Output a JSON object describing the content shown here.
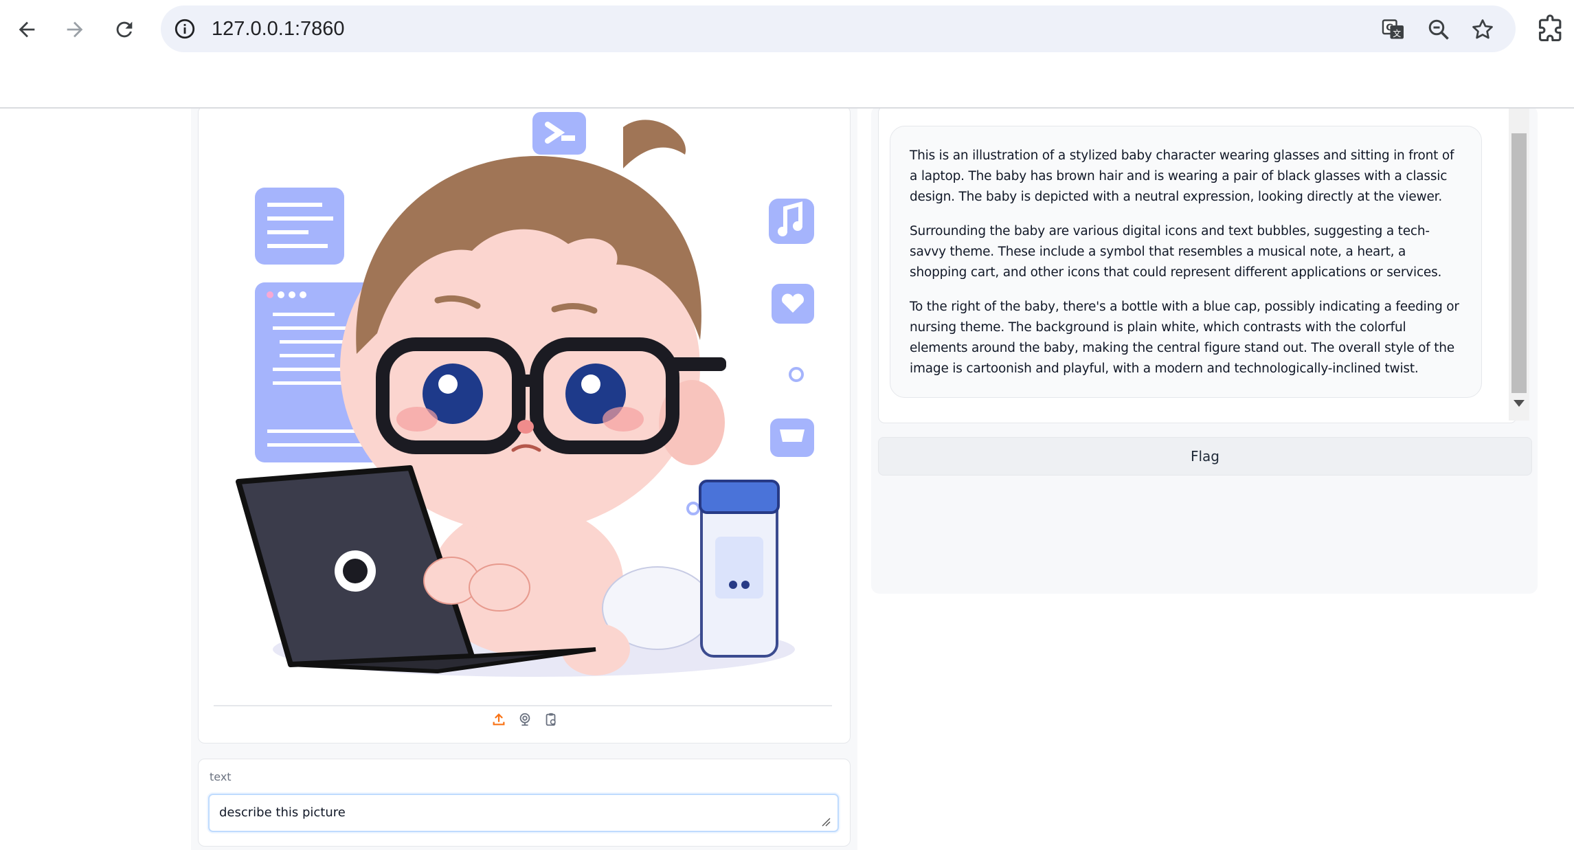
{
  "browser": {
    "url": "127.0.0.1:7860",
    "icons": [
      "back-arrow-icon",
      "forward-arrow-icon",
      "reload-icon",
      "site-info-icon",
      "translate-icon",
      "zoom-icon",
      "bookmark-star-icon",
      "extensions-icon"
    ]
  },
  "image_input": {
    "source_icons": [
      "upload-icon",
      "webcam-icon",
      "clipboard-icon"
    ]
  },
  "text_input": {
    "label": "text",
    "value": "describe this picture"
  },
  "output": {
    "paragraphs": [
      "This is an illustration of a stylized baby character wearing glasses and sitting in front of a laptop. The baby has brown hair and is wearing a pair of black glasses with a classic design. The baby is depicted with a neutral expression, looking directly at the viewer.",
      "Surrounding the baby are various digital icons and text bubbles, suggesting a tech-savvy theme. These include a symbol that resembles a musical note, a heart, a shopping cart, and other icons that could represent different applications or services.",
      "To the right of the baby, there's a bottle with a blue cap, possibly indicating a feeding or nursing theme. The background is plain white, which contrasts with the colorful elements around the baby, making the central figure stand out. The overall style of the image is cartoonish and playful, with a modern and technologically-inclined twist."
    ]
  },
  "flag_button": {
    "label": "Flag"
  },
  "colors": {
    "accent_orange": "#f97316",
    "icon_lavender": "#a5b4fc",
    "input_border": "#bfdbfe"
  }
}
